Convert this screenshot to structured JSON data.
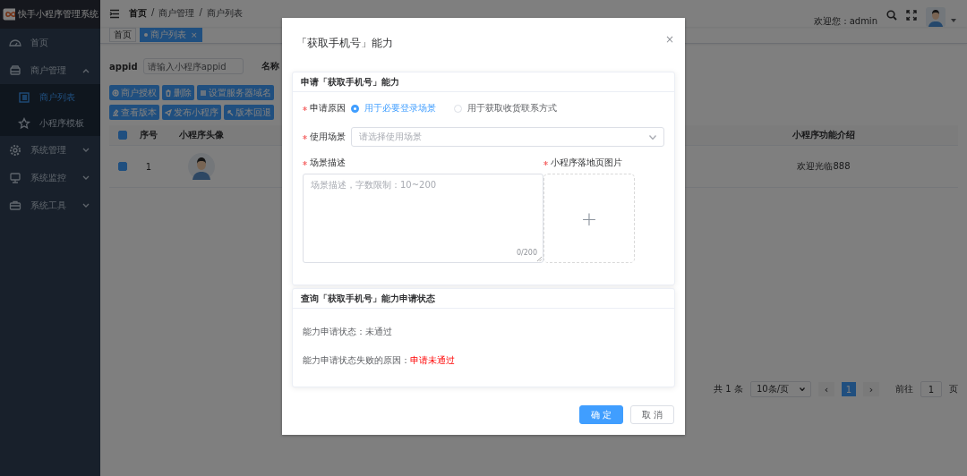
{
  "app": {
    "title": "快手小程序管理系统"
  },
  "sidebar": {
    "items": [
      {
        "kind": "link",
        "label": "首页",
        "selected": false
      },
      {
        "kind": "group",
        "label": "商户管理",
        "selected": false,
        "expanded": true,
        "children": [
          {
            "label": "商户列表",
            "selected": true
          },
          {
            "label": "小程序模板",
            "selected": false
          }
        ]
      },
      {
        "kind": "group",
        "label": "系统管理",
        "selected": false,
        "expanded": false
      },
      {
        "kind": "group",
        "label": "系统监控",
        "selected": false,
        "expanded": false
      },
      {
        "kind": "group",
        "label": "系统工具",
        "selected": false,
        "expanded": false
      }
    ]
  },
  "breadcrumb": {
    "separator": "/",
    "items": [
      "首页",
      "商户管理",
      "商户列表"
    ]
  },
  "header": {
    "welcome": "欢迎您：admin"
  },
  "tags": [
    {
      "label": "首页",
      "selected": false
    },
    {
      "label": "商户列表",
      "selected": true,
      "close": "×"
    }
  ],
  "search": {
    "fields": [
      {
        "label": "appid",
        "placeholder": "请输入小程序appid"
      },
      {
        "label": "名称"
      }
    ]
  },
  "toolbar": {
    "rows": [
      [
        "商户授权",
        "删除",
        "设置服务器域名"
      ],
      [
        "查看版本",
        "发布小程序",
        "版本回退"
      ]
    ]
  },
  "table": {
    "header_checked": true,
    "columns": [
      "序号",
      "小程序头像",
      "小程序功能介绍"
    ],
    "rows": [
      {
        "checked": true,
        "index": "1",
        "intro": "欢迎光临888"
      }
    ]
  },
  "pagination": {
    "total": "共 1 条",
    "size": "10条/页",
    "prev": "‹",
    "pages": [
      {
        "label": "1",
        "selected": true
      }
    ],
    "next": "›",
    "goto": "前往",
    "page_input": "1",
    "page_unit": "页"
  },
  "dialog": {
    "title": "「获取手机号」能力",
    "close": "×",
    "apply_card": {
      "title": "申请「获取手机号」能力",
      "reason": {
        "label": "申请原因",
        "required": true,
        "options": [
          {
            "label": "用于必要登录场景",
            "selected": true
          },
          {
            "label": "用于获取收货联系方式",
            "selected": false
          }
        ]
      },
      "scene": {
        "label": "使用场景",
        "required": true,
        "placeholder": "请选择使用场景"
      },
      "description": {
        "label": "场景描述",
        "required": true,
        "placeholder": "场景描述，字数限制：10~200",
        "counter": "0/200"
      },
      "landing_image": {
        "label": "小程序落地页图片",
        "required": true,
        "plus": "+"
      }
    },
    "status_card": {
      "title": "查询「获取手机号」能力申请状态",
      "lines": [
        {
          "label": "能力申请状态：未通过"
        },
        {
          "label": "能力申请状态失败的原因：",
          "value": "申请未通过"
        }
      ]
    },
    "buttons": [
      {
        "label": "确 定",
        "kind": "primary"
      },
      {
        "label": "取 消",
        "kind": "default"
      }
    ]
  }
}
